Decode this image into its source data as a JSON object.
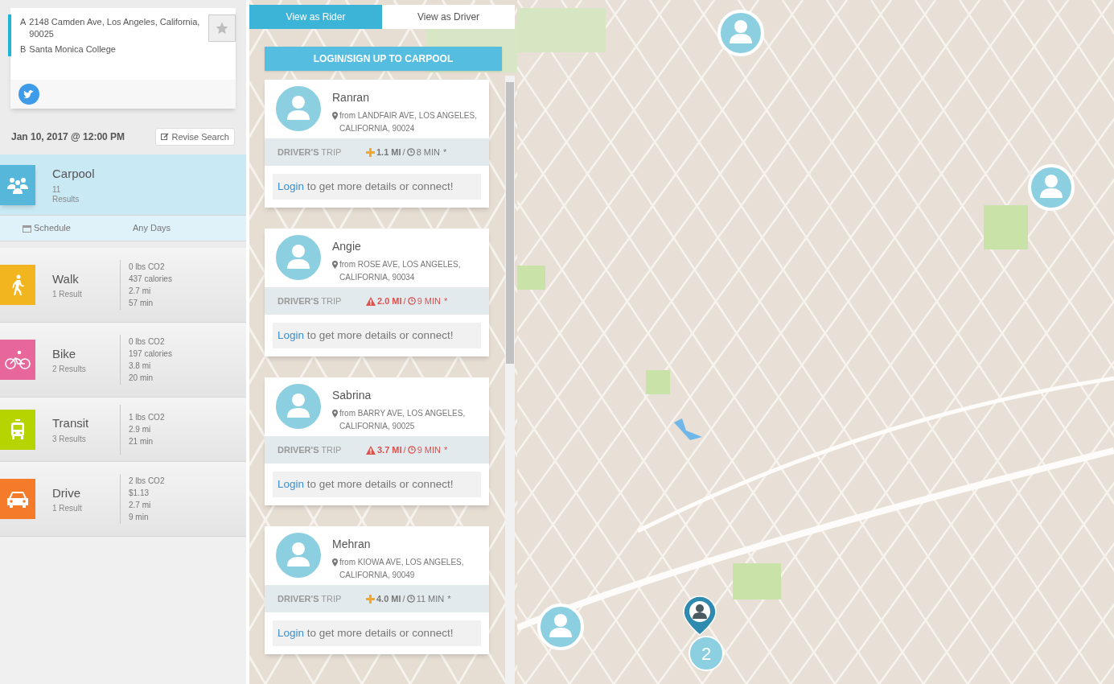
{
  "route": {
    "origin_marker": "A",
    "origin": "2148 Camden Ave, Los Angeles, California, 90025",
    "destination_marker": "B",
    "destination": "Santa Monica College",
    "starred": false
  },
  "date_time": "Jan 10, 2017 @ 12:00 PM",
  "revise_button": "Revise Search",
  "modes": [
    {
      "kind": "carpool",
      "name": "Carpool",
      "results": "11 Results",
      "color": "#56b7db",
      "selected": true
    },
    {
      "kind": "walk",
      "name": "Walk",
      "results": "1 Result",
      "color": "#f2b51f",
      "selected": false,
      "stats": [
        "0 lbs CO2",
        "437 calories",
        "2.7 mi",
        "57 min"
      ]
    },
    {
      "kind": "bike",
      "name": "Bike",
      "results": "2 Results",
      "color": "#e8679a",
      "selected": false,
      "stats": [
        "0 lbs CO2",
        "197 calories",
        "3.8 mi",
        "20 min"
      ]
    },
    {
      "kind": "transit",
      "name": "Transit",
      "results": "3 Results",
      "color": "#b5d400",
      "selected": false,
      "stats": [
        "1 lbs CO2",
        "2.9 mi",
        "21 min"
      ]
    },
    {
      "kind": "drive",
      "name": "Drive",
      "results": "1 Result",
      "color": "#f47b2a",
      "selected": false,
      "stats": [
        "2 lbs CO2",
        "$1.13",
        "2.7 mi",
        "9 min"
      ]
    }
  ],
  "schedule": {
    "label": "Schedule",
    "value": "Any Days"
  },
  "view_tabs": [
    {
      "label": "View as Rider",
      "selected": true
    },
    {
      "label": "View as Driver",
      "selected": false
    }
  ],
  "login_button": "LOGIN/SIGN UP TO CARPOOL",
  "drivers": [
    {
      "name": "Ranran",
      "from": "from LANDFAIR AVE, LOS ANGELES, CALIFORNIA, 90024",
      "trip_label": "**DRIVER'S** TRIP",
      "kind": "ok",
      "distance": "1.1 MI",
      "separator": "/",
      "duration": "8 MIN",
      "note": "*",
      "login_link": "Login",
      "login_text": "to get more details or connect!"
    },
    {
      "name": "Angie",
      "from": "from ROSE AVE, LOS ANGELES, CALIFORNIA, 90034",
      "trip_label": "**DRIVER'S** TRIP",
      "kind": "warning",
      "distance": "2.0 MI",
      "separator": "/",
      "duration": "9 MIN",
      "note": "*",
      "login_link": "Login",
      "login_text": "to get more details or connect!"
    },
    {
      "name": "Sabrina",
      "from": "from BARRY AVE, LOS ANGELES, CALIFORNIA, 90025",
      "trip_label": "**DRIVER'S** TRIP",
      "kind": "warning",
      "distance": "3.7 MI",
      "separator": "/",
      "duration": "9 MIN",
      "note": "*",
      "login_link": "Login",
      "login_text": "to get more details or connect!"
    },
    {
      "name": "Mehran",
      "from": "from KIOWA AVE, LOS ANGELES, CALIFORNIA, 90049",
      "trip_label": "**DRIVER'S** TRIP",
      "kind": "ok",
      "distance": "4.0 MI",
      "separator": "/",
      "duration": "11 MIN",
      "note": "*",
      "login_link": "Login",
      "login_text": "to get more details or connect!"
    }
  ],
  "map": {
    "cluster_count": "2"
  }
}
